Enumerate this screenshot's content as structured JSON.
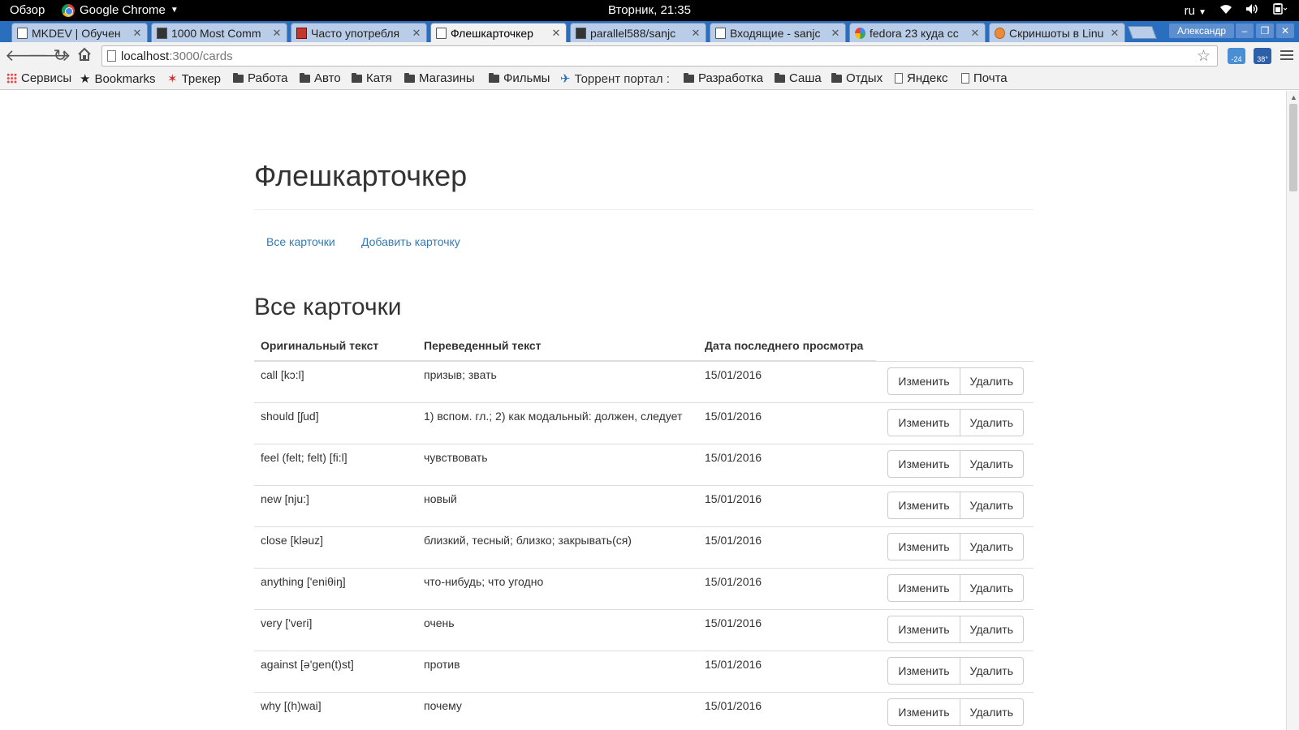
{
  "gnome": {
    "activities": "Обзор",
    "app_name": "Google Chrome",
    "clock": "Вторник, 21:35",
    "lang": "ru"
  },
  "tabs": [
    {
      "label": "MKDEV | Обучен",
      "favicon": "doc-icon",
      "active": false
    },
    {
      "label": "1000 Most Comm",
      "favicon": "site-icon",
      "active": false
    },
    {
      "label": "Часто употребля",
      "favicon": "home-icon",
      "active": false
    },
    {
      "label": "Флешкарточкер",
      "favicon": "doc-icon",
      "active": true
    },
    {
      "label": "parallel588/sanjc",
      "favicon": "github-icon",
      "active": false
    },
    {
      "label": "Входящие - sanjc",
      "favicon": "doc-icon",
      "active": false
    },
    {
      "label": "fedora 23 куда сс",
      "favicon": "google-icon",
      "active": false
    },
    {
      "label": "Скриншоты в Linu",
      "favicon": "site-icon",
      "active": false
    }
  ],
  "profile_name": "Александр",
  "omnibox": {
    "host": "localhost",
    "path": ":3000/cards"
  },
  "extensions": {
    "badge1": "-24",
    "badge2": "38°"
  },
  "bookmarks": [
    {
      "label": "Сервисы",
      "icon": "apps-icon"
    },
    {
      "label": "Bookmarks",
      "icon": "star-icon"
    },
    {
      "label": "Трекер",
      "icon": "tracker-icon"
    },
    {
      "label": "Работа",
      "icon": "folder-icon"
    },
    {
      "label": "Авто",
      "icon": "folder-icon"
    },
    {
      "label": "Катя",
      "icon": "folder-icon"
    },
    {
      "label": "Магазины",
      "icon": "folder-icon"
    },
    {
      "label": "Фильмы",
      "icon": "folder-icon"
    },
    {
      "label": "Торрент портал :",
      "icon": "torrent-icon"
    },
    {
      "label": "Разработка",
      "icon": "folder-icon"
    },
    {
      "label": "Саша",
      "icon": "folder-icon"
    },
    {
      "label": "Отдых",
      "icon": "folder-icon"
    },
    {
      "label": "Яндекс",
      "icon": "page-icon"
    },
    {
      "label": "Почта",
      "icon": "page-icon"
    }
  ],
  "page": {
    "title": "Флешкарточкер",
    "nav": {
      "all_cards": "Все карточки",
      "add_card": "Добавить карточку"
    },
    "section_title": "Все карточки",
    "table": {
      "headers": [
        "Оригинальный текст",
        "Переведенный текст",
        "Дата последнего просмотра"
      ],
      "edit_label": "Изменить",
      "delete_label": "Удалить",
      "rows": [
        {
          "original": "call [kɔ:l]",
          "translated": "призыв; звать",
          "date": "15/01/2016"
        },
        {
          "original": "should [ʃud]",
          "translated": "1) вспом. гл.; 2) как модальный: должен, следует",
          "date": "15/01/2016"
        },
        {
          "original": "feel (felt; felt) [fi:l]",
          "translated": "чувствовать",
          "date": "15/01/2016"
        },
        {
          "original": "new [nju:]",
          "translated": "новый",
          "date": "15/01/2016"
        },
        {
          "original": "close [kləuz]",
          "translated": "близкий, тесный; близко; закрывать(ся)",
          "date": "15/01/2016"
        },
        {
          "original": "anything ['eniθiŋ]",
          "translated": "что-нибудь; что угодно",
          "date": "15/01/2016"
        },
        {
          "original": "very ['veri]",
          "translated": "очень",
          "date": "15/01/2016"
        },
        {
          "original": "against [ə'gen(t)st]",
          "translated": "против",
          "date": "15/01/2016"
        },
        {
          "original": "why [(h)wai]",
          "translated": "почему",
          "date": "15/01/2016"
        }
      ]
    }
  }
}
